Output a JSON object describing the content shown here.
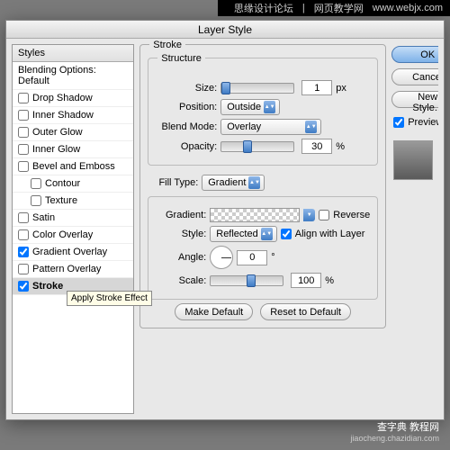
{
  "watermarks": {
    "top_left_cn": "思缘设计论坛",
    "top_right_cn": "网页教学网",
    "top_right_url": "www.webjx.com",
    "bottom_main": "查字典 教程网",
    "bottom_sub": "jiaocheng.chazidian.com"
  },
  "dialog": {
    "title": "Layer Style",
    "styles_header": "Styles",
    "blending_label": "Blending Options: Default",
    "items": [
      {
        "label": "Drop Shadow",
        "checked": false
      },
      {
        "label": "Inner Shadow",
        "checked": false
      },
      {
        "label": "Outer Glow",
        "checked": false
      },
      {
        "label": "Inner Glow",
        "checked": false
      },
      {
        "label": "Bevel and Emboss",
        "checked": false
      },
      {
        "label": "Contour",
        "checked": false,
        "indent": true
      },
      {
        "label": "Texture",
        "checked": false,
        "indent": true
      },
      {
        "label": "Satin",
        "checked": false
      },
      {
        "label": "Color Overlay",
        "checked": false
      },
      {
        "label": "Gradient Overlay",
        "checked": true
      },
      {
        "label": "Pattern Overlay",
        "checked": false
      },
      {
        "label": "Stroke",
        "checked": true,
        "selected": true
      }
    ],
    "tooltip": "Apply Stroke Effect"
  },
  "stroke": {
    "group_label": "Stroke",
    "structure_label": "Structure",
    "size_label": "Size:",
    "size_value": "1",
    "size_unit": "px",
    "position_label": "Position:",
    "position_value": "Outside",
    "blendmode_label": "Blend Mode:",
    "blendmode_value": "Overlay",
    "opacity_label": "Opacity:",
    "opacity_value": "30",
    "opacity_unit": "%",
    "filltype_label": "Fill Type:",
    "filltype_value": "Gradient",
    "gradient_label": "Gradient:",
    "reverse_label": "Reverse",
    "style_label": "Style:",
    "style_value": "Reflected",
    "align_label": "Align with Layer",
    "angle_label": "Angle:",
    "angle_value": "0",
    "angle_unit": "°",
    "scale_label": "Scale:",
    "scale_value": "100",
    "scale_unit": "%",
    "make_default": "Make Default",
    "reset_default": "Reset to Default"
  },
  "buttons": {
    "ok": "OK",
    "cancel": "Cancel",
    "new_style": "New Style...",
    "preview": "Preview"
  }
}
